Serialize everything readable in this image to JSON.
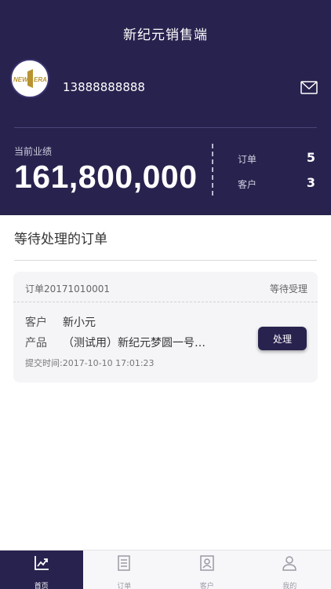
{
  "header": {
    "title": "新纪元销售端",
    "logo_text": "NEW ERA",
    "phone": "13888888888"
  },
  "performance": {
    "label": "当前业绩",
    "value": "161,800,000",
    "stats": [
      {
        "label": "订单",
        "value": "5"
      },
      {
        "label": "客户",
        "value": "3"
      }
    ]
  },
  "pending": {
    "title": "等待处理的订单",
    "order": {
      "number": "订单20171010001",
      "status": "等待受理",
      "customer_label": "客户",
      "customer_value": "新小元",
      "product_label": "产品",
      "product_value": "（测试用）新纪元梦圆一号…",
      "submit_time": "提交时间:2017-10-10 17:01:23",
      "action_label": "处理"
    }
  },
  "tabs": [
    {
      "label": "首页",
      "icon": "chart-trend-icon",
      "active": true
    },
    {
      "label": "订单",
      "icon": "document-list-icon",
      "active": false
    },
    {
      "label": "客户",
      "icon": "contact-card-icon",
      "active": false
    },
    {
      "label": "我的",
      "icon": "user-icon",
      "active": false
    }
  ],
  "colors": {
    "primary": "#28224e",
    "background": "#ffffff",
    "card": "#f5f5f8"
  }
}
